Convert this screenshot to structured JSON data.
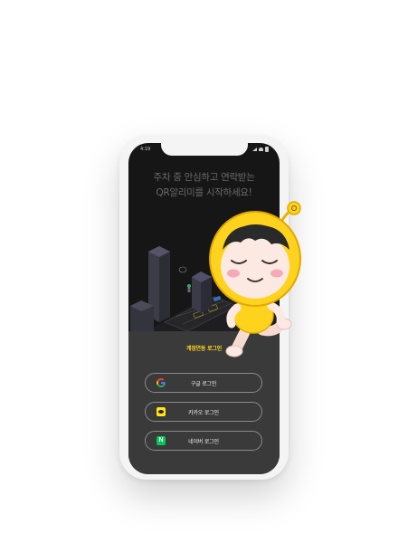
{
  "status_bar": {
    "time": "4:19"
  },
  "headline": {
    "line1": "주차 중 안심하고 연락받는",
    "line2": "QR알리미를 시작하세요!"
  },
  "login_panel": {
    "title": "계정연동 로그인",
    "buttons": [
      {
        "label": "구글 로그인",
        "icon": "google-icon"
      },
      {
        "label": "카카오 로그인",
        "icon": "kakao-icon"
      },
      {
        "label": "네이버 로그인",
        "icon": "naver-icon"
      }
    ],
    "naver_letter": "N"
  },
  "colors": {
    "accent_yellow": "#ffd21e",
    "panel_bg": "#3a3a3a",
    "screen_bg": "#161616",
    "kakao_yellow": "#ffe812",
    "naver_green": "#03c75a"
  }
}
